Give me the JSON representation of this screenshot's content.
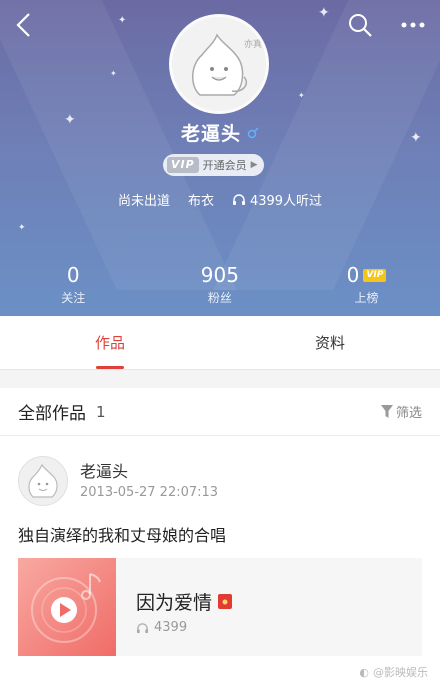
{
  "profile": {
    "name": "老逼头",
    "avatar_text": "亦真相",
    "vip_badge": "VIP",
    "vip_label": "开通会员",
    "info": [
      "尚未出道",
      "布衣"
    ],
    "listens": "4399人听过"
  },
  "stats": [
    {
      "value": "0",
      "label": "关注"
    },
    {
      "value": "905",
      "label": "粉丝"
    },
    {
      "value": "0",
      "label": "上榜",
      "badge": "VIP"
    }
  ],
  "tabs": [
    {
      "label": "作品",
      "active": true
    },
    {
      "label": "资料",
      "active": false
    }
  ],
  "section": {
    "title": "全部作品",
    "count": "1",
    "filter_label": "筛选"
  },
  "post": {
    "author": "老逼头",
    "timestamp": "2013-05-27 22:07:13",
    "text": "独自演绎的我和丈母娘的合唱",
    "song_title": "因为爱情",
    "plays": "4399"
  },
  "watermark": "@影映娱乐",
  "colors": {
    "accent": "#e0403a",
    "header_top": "#6b6aa3",
    "header_bottom": "#6b90c6",
    "cover": "#f06c68"
  }
}
